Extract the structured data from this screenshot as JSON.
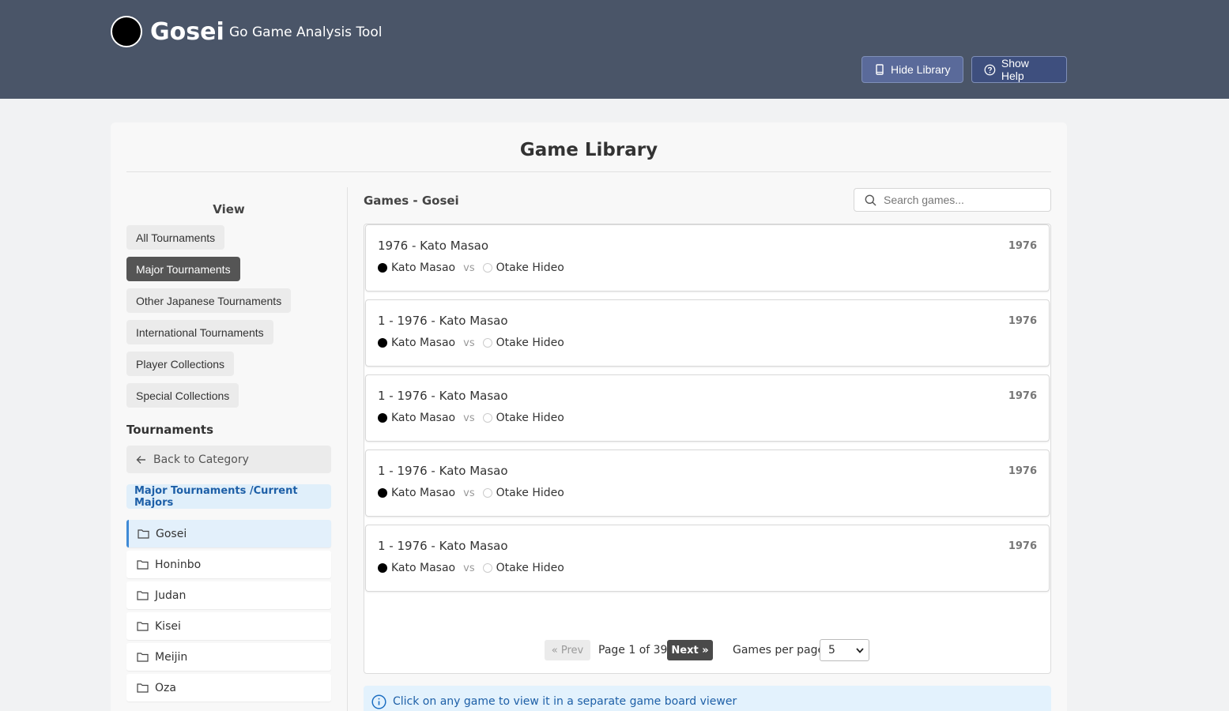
{
  "header": {
    "title": "Gosei",
    "subtitle": "Go Game Analysis Tool",
    "hide_library": "Hide Library",
    "show_help": "Show Help"
  },
  "library": {
    "title": "Game Library",
    "view_title": "View",
    "view_buttons": [
      "All Tournaments",
      "Major Tournaments",
      "Other Japanese Tournaments",
      "International Tournaments",
      "Player Collections",
      "Special Collections"
    ],
    "active_view": "Major Tournaments",
    "tournaments_title": "Tournaments",
    "back_label": "Back to Category",
    "breadcrumb": "Major Tournaments /Current Majors",
    "folders": [
      "Gosei",
      "Honinbo",
      "Judan",
      "Kisei",
      "Meijin",
      "Oza"
    ],
    "active_folder": "Gosei"
  },
  "games": {
    "title": "Games - Gosei",
    "search_placeholder": "Search games...",
    "vs_label": "vs",
    "items": [
      {
        "title": "1976 - Kato Masao",
        "year": "1976",
        "black": "Kato Masao",
        "white": "Otake Hideo"
      },
      {
        "title": "1 - 1976 - Kato Masao",
        "year": "1976",
        "black": "Kato Masao",
        "white": "Otake Hideo"
      },
      {
        "title": "1 - 1976 - Kato Masao",
        "year": "1976",
        "black": "Kato Masao",
        "white": "Otake Hideo"
      },
      {
        "title": "1 - 1976 - Kato Masao",
        "year": "1976",
        "black": "Kato Masao",
        "white": "Otake Hideo"
      },
      {
        "title": "1 - 1976 - Kato Masao",
        "year": "1976",
        "black": "Kato Masao",
        "white": "Otake Hideo"
      }
    ]
  },
  "pagination": {
    "prev": "« Prev",
    "info": "Page 1 of 39",
    "next": "Next »",
    "per_page_label": "Games per page:",
    "per_page_value": "5"
  },
  "info": "Click on any game to view it in a separate game board viewer"
}
